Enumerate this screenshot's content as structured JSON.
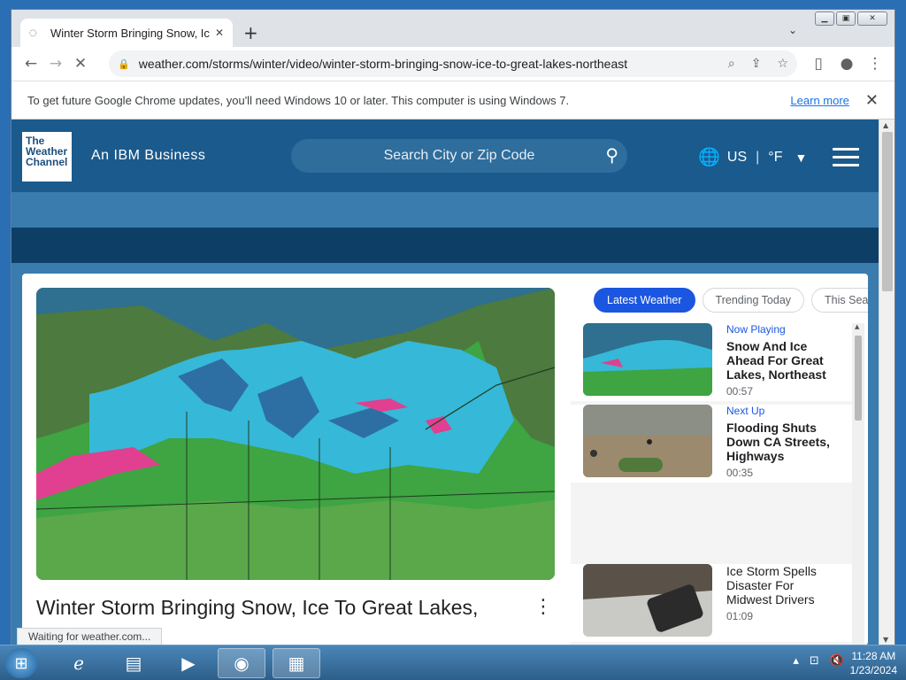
{
  "browser": {
    "tab_title": "Winter Storm Bringing Snow, Ice",
    "url": "weather.com/storms/winter/video/winter-storm-bringing-snow-ice-to-great-lakes-northeast",
    "infobar_message": "To get future Google Chrome updates, you'll need Windows 10 or later. This computer is using Windows 7.",
    "infobar_link": "Learn more",
    "status_text": "Waiting for weather.com..."
  },
  "site": {
    "logo_text": "The Weather Channel",
    "tagline": "An IBM Business",
    "search_placeholder": "Search City or Zip Code",
    "locale": "US",
    "unit": "°F"
  },
  "video": {
    "title": "Winter Storm Bringing Snow, Ice To Great Lakes,"
  },
  "playlist_tabs": [
    {
      "label": "Latest Weather",
      "active": true
    },
    {
      "label": "Trending Today",
      "active": false
    },
    {
      "label": "This Sea",
      "active": false
    }
  ],
  "playlist": [
    {
      "label": "Now Playing",
      "title": "Snow And Ice Ahead For Great Lakes, Northeast",
      "duration": "00:57"
    },
    {
      "label": "Next Up",
      "title": "Flooding Shuts Down CA Streets, Highways",
      "duration": "00:35"
    },
    {
      "label": "",
      "title": "Ice Storm Spells Disaster For Midwest Drivers",
      "duration": "01:09"
    }
  ],
  "taskbar": {
    "time": "11:28 AM",
    "date": "1/23/2024"
  },
  "colors": {
    "header": "#1b5a8c",
    "active_pill": "#1b56e0",
    "accent_link": "#1a73e8"
  }
}
